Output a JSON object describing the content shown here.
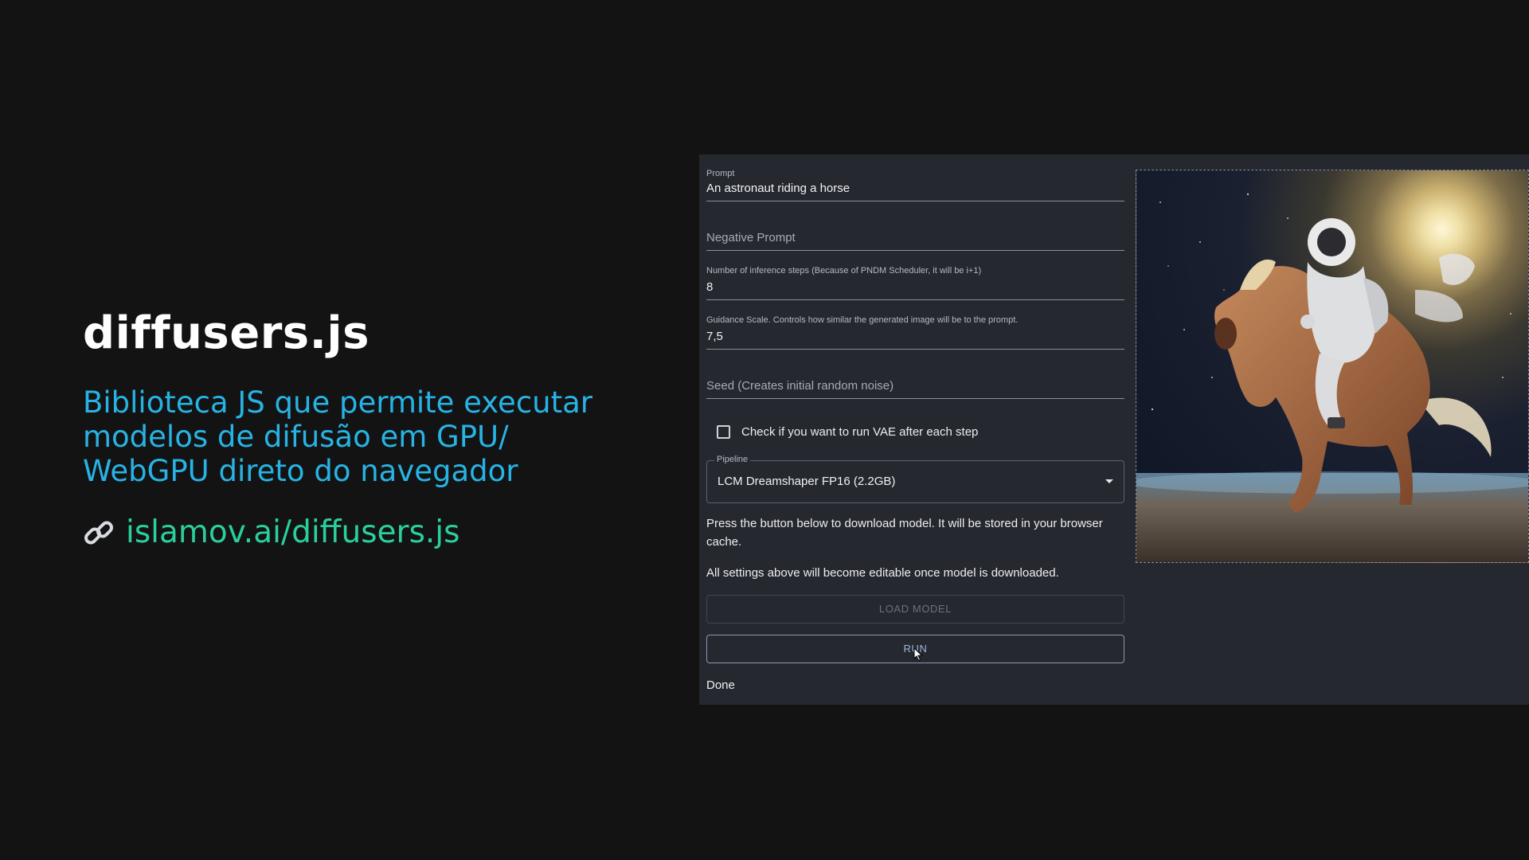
{
  "slide": {
    "title": "diffusers.js",
    "subtitle": "Biblioteca JS que permite executar modelos de difusão em GPU/ WebGPU direto do navegador",
    "link_text": "islamov.ai/diffusers.js",
    "link_icon": "link-icon",
    "colors": {
      "title": "#ffffff",
      "subtitle": "#27b3e4",
      "link": "#2bcf9c",
      "background": "#131314"
    }
  },
  "app": {
    "prompt": {
      "label": "Prompt",
      "value": "An astronaut riding a horse"
    },
    "negative_prompt": {
      "placeholder": "Negative Prompt"
    },
    "steps": {
      "label": "Number of inference steps (Because of PNDM Scheduler, it will be i+1)",
      "value": "8"
    },
    "guidance": {
      "label": "Guidance Scale. Controls how similar the generated image will be to the prompt.",
      "value": "7,5"
    },
    "seed": {
      "placeholder": "Seed (Creates initial random noise)"
    },
    "vae_checkbox": {
      "label": "Check if you want to run VAE after each step",
      "checked": false
    },
    "pipeline": {
      "label": "Pipeline",
      "selected": "LCM Dreamshaper FP16 (2.2GB)"
    },
    "info_download": "Press the button below to download model. It will be stored in your browser cache.",
    "info_editable": "All settings above will become editable once model is downloaded.",
    "load_button": "LOAD MODEL",
    "run_button": "RUN",
    "status": "Done",
    "colors": {
      "panel": "#262830",
      "run_text": "#9ab6dc"
    }
  },
  "generated_image": {
    "depicts": "astronaut riding a horse in space"
  }
}
